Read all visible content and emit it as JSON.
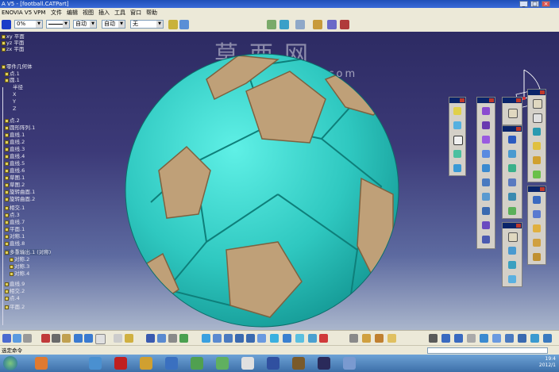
{
  "title": "A V5 - [football.CATPart]",
  "menu": [
    "ENOVIA V5 VPM",
    "文件",
    "编辑",
    "视图",
    "插入",
    "工具",
    "窗口",
    "帮助"
  ],
  "property_bar": {
    "fields": [
      {
        "value": "0%"
      },
      {
        "value": ""
      },
      {
        "value": "自动"
      },
      {
        "value": "自动"
      },
      {
        "value": "无"
      }
    ]
  },
  "watermark": {
    "cn": "莫西网",
    "url": "www.3dmox.com"
  },
  "tree": [
    "xy 平面",
    "yz 平面",
    "zx 平面",
    "零件几何体",
    "点.1",
    "圆.1",
    "半径",
    "X",
    "Y",
    "Z",
    "点.2",
    "圆形阵列.1",
    "直线.1",
    "直线.2",
    "直线.3",
    "直线.4",
    "直线.5",
    "直线.6",
    "草图.1",
    "草图.2",
    "旋转曲面.1",
    "旋转曲面.2",
    "相交.1",
    "点.3",
    "直线.7",
    "平面.1",
    "对称.1",
    "直线.8",
    "多重输出.1 (对称)",
    "对称.2",
    "对称.3",
    "对称.4",
    "直线.9",
    "相交.2",
    "点.4",
    "平面.2"
  ],
  "status": {
    "text": "选定命令"
  },
  "clock": {
    "time": "19:4",
    "date": "2012/1"
  },
  "colors": {
    "ball_cyan": "#36d2c8",
    "ball_patch": "#bfa078",
    "background_top": "#2d2b63"
  }
}
